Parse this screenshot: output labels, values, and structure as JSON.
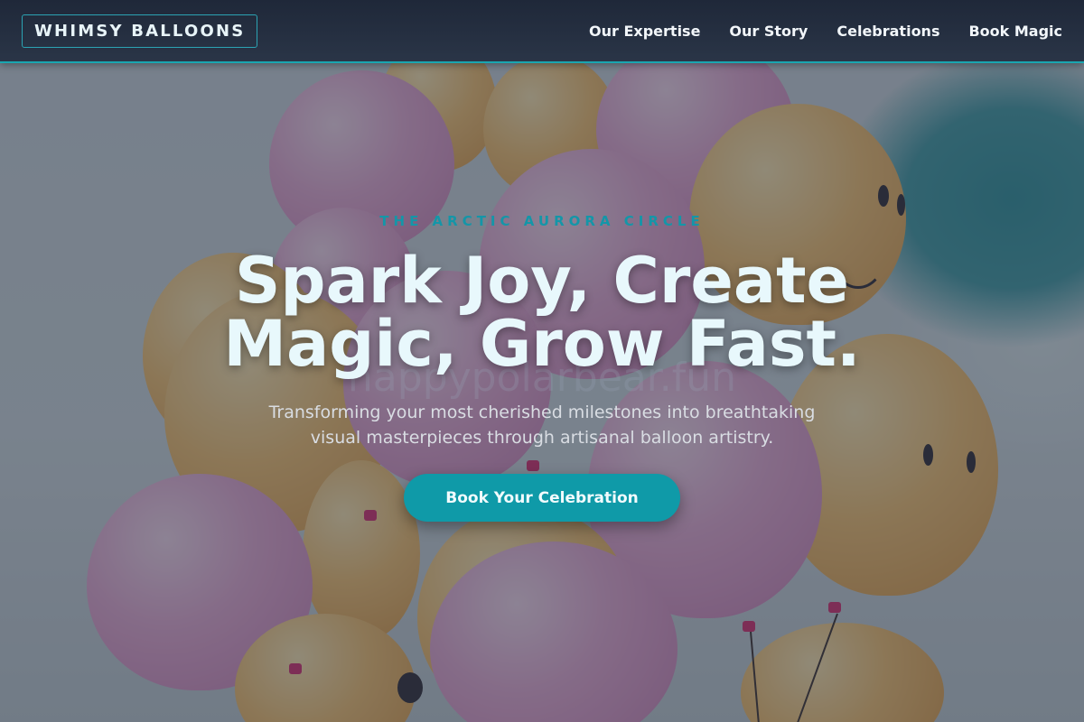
{
  "brand": {
    "logo_text": "WHIMSY BALLOONS"
  },
  "nav": {
    "links": [
      {
        "label": "Our Expertise"
      },
      {
        "label": "Our Story"
      },
      {
        "label": "Celebrations"
      },
      {
        "label": "Book Magic"
      }
    ]
  },
  "hero": {
    "eyebrow": "THE ARCTIC AURORA CIRCLE",
    "headline_line1": "Spark Joy, Create",
    "headline_line2": "Magic, Grow Fast.",
    "subtitle_line1": "Transforming your most cherished milestones into breathtaking",
    "subtitle_line2": "visual masterpieces through artisanal balloon artistry.",
    "cta_label": "Book Your Celebration",
    "watermark": "happypolarbear.fun"
  },
  "colors": {
    "accent": "#0f9aa8",
    "nav_background": "#1f2839",
    "eyebrow": "#1496a8",
    "headline": "#e8f8fc"
  }
}
